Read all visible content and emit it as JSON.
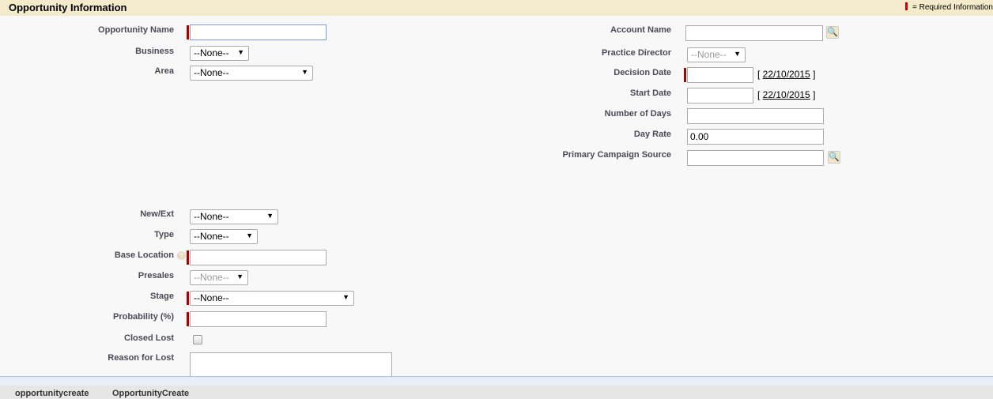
{
  "header": {
    "title": "Opportunity Information",
    "required_legend": "= Required Information"
  },
  "left": {
    "opportunity_name": {
      "label": "Opportunity Name",
      "value": ""
    },
    "business": {
      "label": "Business",
      "value": "--None--"
    },
    "area": {
      "label": "Area",
      "value": "--None--"
    },
    "new_ext": {
      "label": "New/Ext",
      "value": "--None--"
    },
    "type": {
      "label": "Type",
      "value": "--None--"
    },
    "base_location": {
      "label": "Base Location",
      "value": "",
      "help": "?"
    },
    "presales": {
      "label": "Presales",
      "value": "--None--"
    },
    "stage": {
      "label": "Stage",
      "value": "--None--"
    },
    "probability": {
      "label": "Probability (%)",
      "value": ""
    },
    "closed_lost": {
      "label": "Closed Lost",
      "checked": false
    },
    "reason_for_lost": {
      "label": "Reason for Lost",
      "value": ""
    }
  },
  "right": {
    "account_name": {
      "label": "Account Name",
      "value": ""
    },
    "practice_director": {
      "label": "Practice Director",
      "value": "--None--"
    },
    "decision_date": {
      "label": "Decision Date",
      "value": "",
      "today": "22/10/2015"
    },
    "start_date": {
      "label": "Start Date",
      "value": "",
      "today": "22/10/2015"
    },
    "number_of_days": {
      "label": "Number of Days",
      "value": ""
    },
    "day_rate": {
      "label": "Day Rate",
      "value": "0.00"
    },
    "primary_campaign_source": {
      "label": "Primary Campaign Source",
      "value": ""
    }
  },
  "footer": {
    "items": [
      "opportunitycreate",
      "OpportunityCreate"
    ]
  },
  "colors": {
    "required": "#aa0000",
    "header_bg": "#f3ebcc"
  }
}
